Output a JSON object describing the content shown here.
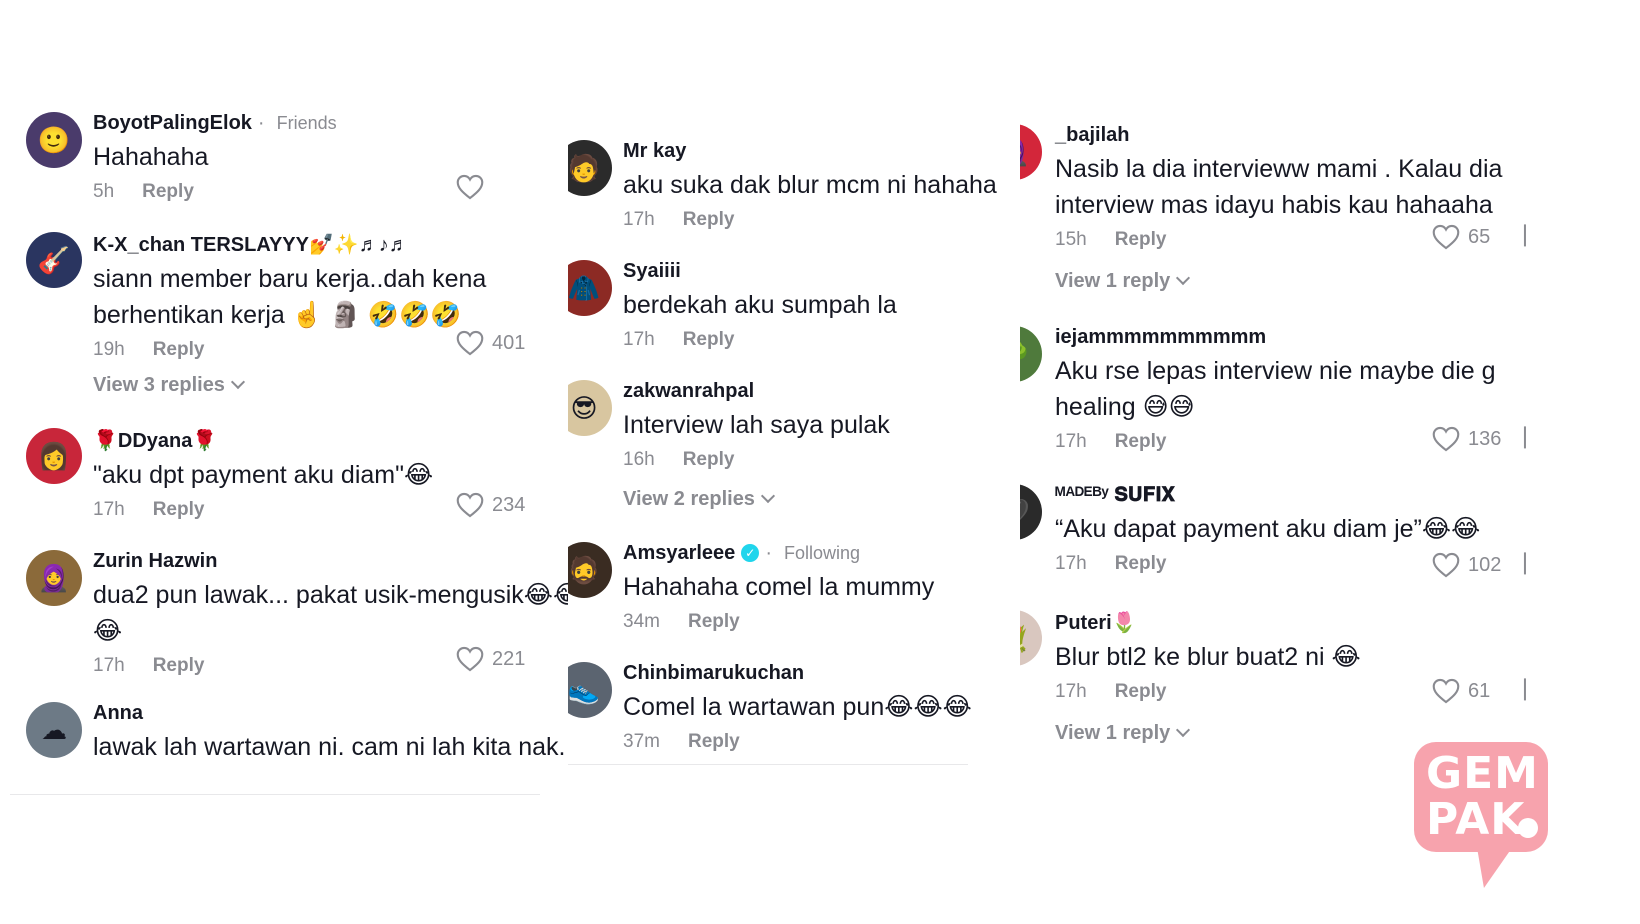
{
  "columns": [
    {
      "comments": [
        {
          "username": "BoyotPalingElok",
          "tag": "Friends",
          "text": [
            "Hahahaha"
          ],
          "time": "5h",
          "reply": "Reply",
          "likes": "",
          "avatar_color": "#4a3b6b"
        },
        {
          "username": "K-X_chan TERSLAYYY💅✨♬♪♬",
          "text": [
            "siann member baru kerja..dah kena",
            "berhentikan kerja ☝️ 🗿 🤣🤣🤣"
          ],
          "time": "19h",
          "reply": "Reply",
          "likes": "401",
          "view_replies": "View 3 replies",
          "avatar_color": "#2a3560"
        },
        {
          "username": "🌹DDyana🌹",
          "text": [
            "\"aku dpt payment aku diam\"😂"
          ],
          "time": "17h",
          "reply": "Reply",
          "likes": "234",
          "avatar_color": "#c8263a"
        },
        {
          "username": "Zurin Hazwin",
          "text": [
            "dua2 pun lawak... pakat usik-mengusik😂😂",
            "😂"
          ],
          "time": "17h",
          "reply": "Reply",
          "likes": "221",
          "avatar_color": "#8b6a3a"
        },
        {
          "username": "Anna",
          "text": [
            "lawak lah wartawan ni. cam ni lah kita nak."
          ],
          "time": "",
          "reply": "",
          "likes": "",
          "avatar_color": "#6d7a86"
        }
      ]
    },
    {
      "comments": [
        {
          "username": "Mr kay",
          "text": [
            "aku suka dak blur mcm ni hahaha"
          ],
          "time": "17h",
          "reply": "Reply",
          "likes": "",
          "avatar_color": "#2b2b2b"
        },
        {
          "username": "Syaiiii",
          "text": [
            "berdekah aku sumpah la"
          ],
          "time": "17h",
          "reply": "Reply",
          "likes": "",
          "avatar_color": "#8c2a24"
        },
        {
          "username": "zakwanrahpal",
          "text": [
            "Interview lah saya pulak"
          ],
          "time": "16h",
          "reply": "Reply",
          "likes": "",
          "view_replies": "View 2 replies",
          "avatar_color": "#d8c6a0"
        },
        {
          "username": "Amsyarleee",
          "verified": true,
          "tag": "Following",
          "text": [
            "Hahahaha comel la mummy"
          ],
          "time": "34m",
          "reply": "Reply",
          "likes": "",
          "avatar_color": "#3a2c22"
        },
        {
          "username": "Chinbimarukuchan",
          "text": [
            "Comel la wartawan pun😂😂😂"
          ],
          "time": "37m",
          "reply": "Reply",
          "likes": "",
          "avatar_color": "#5b6470"
        }
      ]
    },
    {
      "comments": [
        {
          "username": "_bajilah",
          "text": [
            "Nasib la dia intervieww mami . Kalau dia",
            "interview mas idayu habis kau hahaaha"
          ],
          "time": "15h",
          "reply": "Reply",
          "likes": "65",
          "view_replies": "View 1 reply",
          "avatar_color": "#d3263a"
        },
        {
          "username": "iejammmmmmmmmm",
          "text": [
            "Aku rse lepas interview nie maybe die g",
            "healing 😅😅"
          ],
          "time": "17h",
          "reply": "Reply",
          "likes": "136",
          "avatar_color": "#4f7a3c"
        },
        {
          "username": "ᴹᴬᴰᴱᴮʸ 𝐒𝐔𝐅𝐈𝐗",
          "text": [
            "“Aku dapat payment aku diam je”😂😂"
          ],
          "time": "17h",
          "reply": "Reply",
          "likes": "102",
          "avatar_color": "#2a2a2a"
        },
        {
          "username": "Puteri🌷",
          "text": [
            "Blur btl2 ke blur buat2 ni 😂"
          ],
          "time": "17h",
          "reply": "Reply",
          "likes": "61",
          "view_replies": "View 1 reply",
          "avatar_color": "#d9c7bf"
        }
      ]
    }
  ],
  "watermark": {
    "line1": "GEM",
    "line2": "PAK"
  },
  "colors": {
    "text": "#161823",
    "secondary": "#8a8b91",
    "watermark": "#f7a3ad"
  }
}
